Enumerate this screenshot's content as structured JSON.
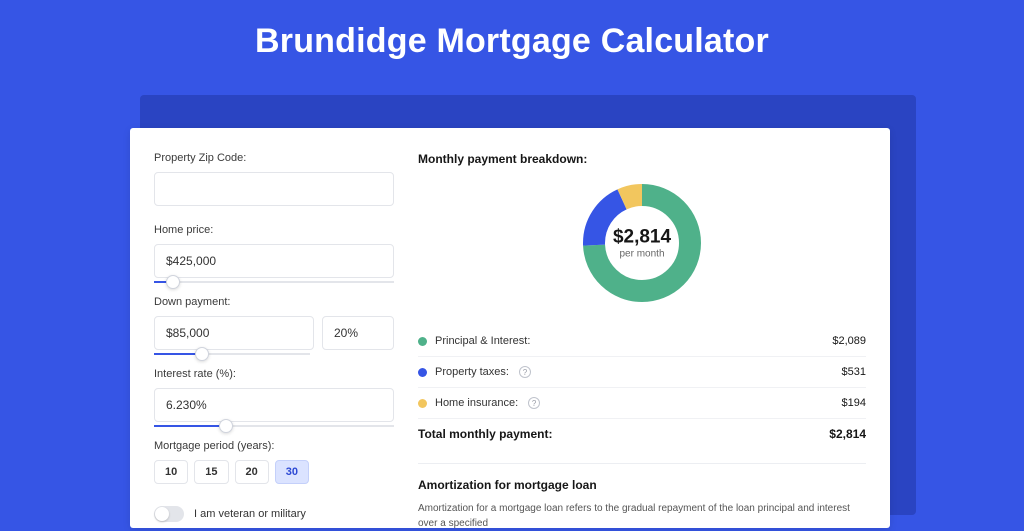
{
  "page": {
    "title": "Brundidge Mortgage Calculator"
  },
  "form": {
    "zip": {
      "label": "Property Zip Code:",
      "value": ""
    },
    "home_price": {
      "label": "Home price:",
      "value": "$425,000",
      "slider_percent": 8
    },
    "down_payment": {
      "label": "Down payment:",
      "amount": "$85,000",
      "percent": "20%",
      "slider_percent": 20
    },
    "interest": {
      "label": "Interest rate (%):",
      "value": "6.230%",
      "slider_percent": 30
    },
    "period": {
      "label": "Mortgage period (years):",
      "options": [
        "10",
        "15",
        "20",
        "30"
      ],
      "selected": "30"
    },
    "veteran": {
      "label": "I am veteran or military",
      "checked": false
    }
  },
  "breakdown": {
    "title": "Monthly payment breakdown:",
    "center_amount": "$2,814",
    "center_sub": "per month",
    "items": [
      {
        "label": "Principal & Interest:",
        "value": "$2,089",
        "color": "#4FB18A",
        "help": false
      },
      {
        "label": "Property taxes:",
        "value": "$531",
        "color": "#3655E5",
        "help": true
      },
      {
        "label": "Home insurance:",
        "value": "$194",
        "color": "#F2C65E",
        "help": true
      }
    ],
    "total_label": "Total monthly payment:",
    "total_value": "$2,814"
  },
  "chart_data": {
    "type": "pie",
    "title": "Monthly payment breakdown",
    "series": [
      {
        "name": "Principal & Interest",
        "value": 2089,
        "color": "#4FB18A"
      },
      {
        "name": "Property taxes",
        "value": 531,
        "color": "#3655E5"
      },
      {
        "name": "Home insurance",
        "value": 194,
        "color": "#F2C65E"
      }
    ],
    "total": 2814,
    "center_label": "$2,814 per month",
    "donut": true
  },
  "amortization": {
    "title": "Amortization for mortgage loan",
    "text": "Amortization for a mortgage loan refers to the gradual repayment of the loan principal and interest over a specified"
  }
}
